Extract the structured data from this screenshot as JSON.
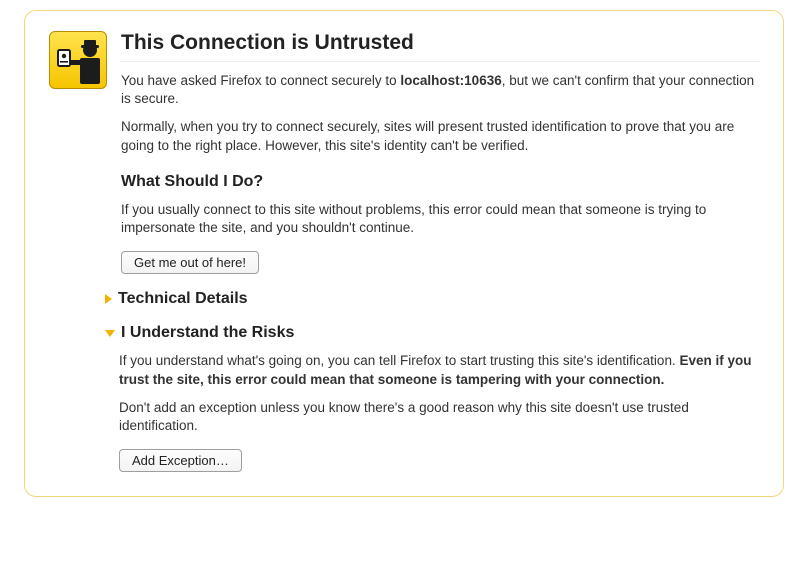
{
  "title": "This Connection is Untrusted",
  "intro": {
    "prefix": "You have asked Firefox to connect securely to ",
    "host": "localhost:10636",
    "suffix": ", but we can't confirm that your connection is secure."
  },
  "normally": "Normally, when you try to connect securely, sites will present trusted identification to prove that you are going to the right place. However, this site's identity can't be verified.",
  "what_heading": "What Should I Do?",
  "what_para": "If you usually connect to this site without problems, this error could mean that someone is trying to impersonate the site, and you shouldn't continue.",
  "get_out_label": "Get me out of here!",
  "technical_heading": "Technical Details",
  "risks_heading": "I Understand the Risks",
  "risks_para1": {
    "prefix": "If you understand what's going on, you can tell Firefox to start trusting this site's identification. ",
    "bold": "Even if you trust the site, this error could mean that someone is tampering with your connection."
  },
  "risks_para2": "Don't add an exception unless you know there's a good reason why this site doesn't use trusted identification.",
  "add_exception_label": "Add Exception…"
}
